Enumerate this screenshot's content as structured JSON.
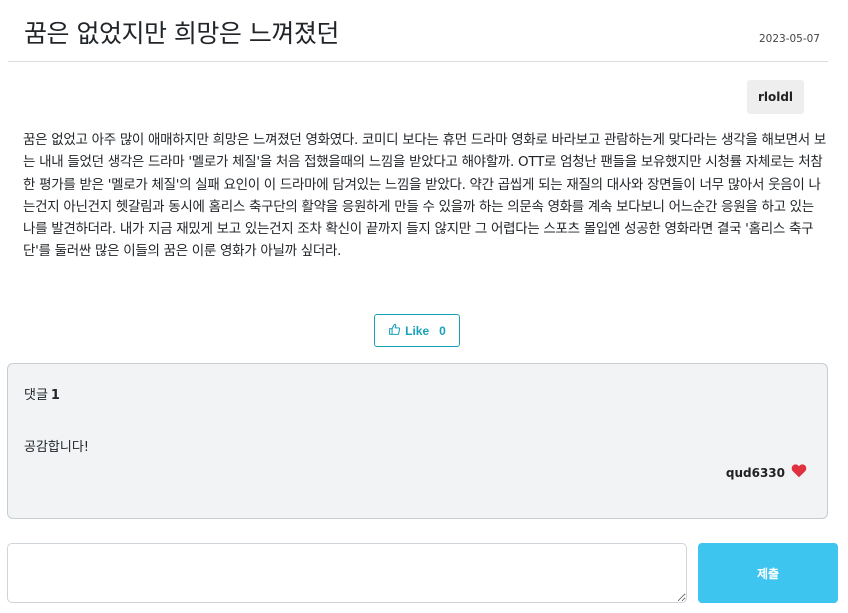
{
  "post": {
    "title": "꿈은 없었지만 희망은 느껴졌던",
    "date": "2023-05-07",
    "author": "rloldl",
    "body": "꿈은 없었고 아주 많이 애매하지만 희망은 느껴졌던 영화였다. 코미디 보다는 휴먼 드라마 영화로 바라보고 관람하는게 맞다라는 생각을 해보면서 보는 내내 들었던 생각은 드라마 '멜로가 체질'을 처음 접했을때의 느낌을 받았다고 해야할까. OTT로 엄청난 팬들을 보유했지만 시청률 자체로는 처참한 평가를 받은 '멜로가 체질'의 실패 요인이 이 드라마에 담겨있는 느낌을 받았다. 약간 곱씹게 되는 재질의 대사와 장면들이 너무 많아서 웃음이 나는건지 아닌건지 헷갈림과 동시에 홈리스 축구단의 활약을 응원하게 만들 수 있을까 하는 의문속 영화를 계속 보다보니 어느순간 응원을 하고 있는 나를 발견하더라. 내가 지금 재밌게 보고 있는건지 조차 확신이 끝까지 들지 않지만 그 어렵다는 스포츠 몰입엔 성공한 영화라면 결국 '홈리스 축구단'를 둘러싼 많은 이들의 꿈은 이룬 영화가 아닐까 싶더라."
  },
  "like": {
    "label": "Like",
    "count": "0",
    "icon": "thumbs-up-icon"
  },
  "comments": {
    "heading": "댓글",
    "count": "1",
    "items": [
      {
        "text": "공감합니다!",
        "author": "qud6330",
        "icon": "heart-icon"
      }
    ]
  },
  "form": {
    "placeholder": "",
    "submit_label": "제출"
  },
  "colors": {
    "accent": "#17a2b8",
    "submit": "#3dc5f0",
    "heart": "#e0313f",
    "card_bg": "#f1f3f5"
  }
}
